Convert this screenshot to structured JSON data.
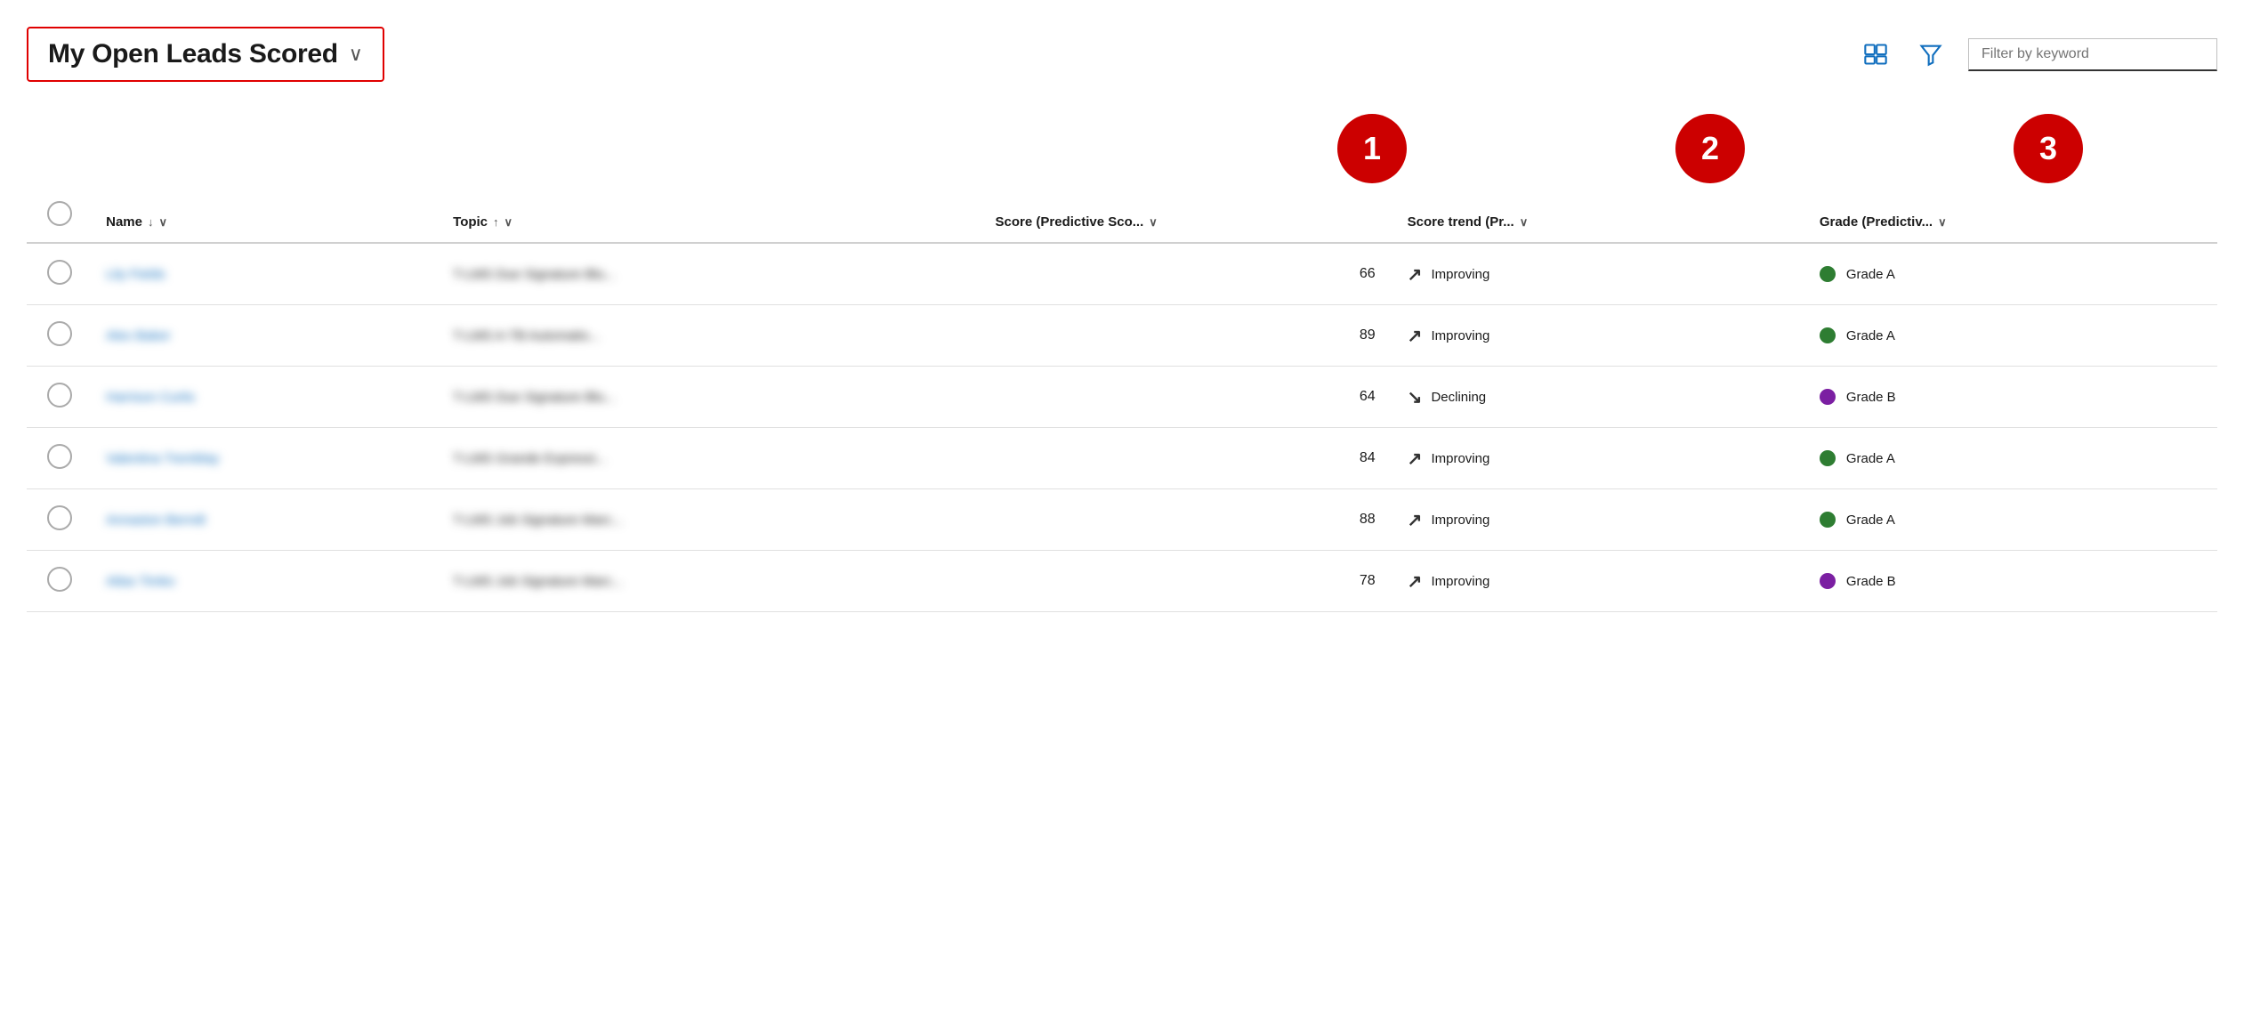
{
  "header": {
    "title": "My Open Leads Scored",
    "chevron": "∨",
    "filter_placeholder": "Filter by keyword"
  },
  "icons": {
    "layout_icon": "layout",
    "filter_icon": "filter"
  },
  "annotations": [
    {
      "number": "1"
    },
    {
      "number": "2"
    },
    {
      "number": "3"
    }
  ],
  "table": {
    "columns": [
      {
        "id": "checkbox",
        "label": ""
      },
      {
        "id": "name",
        "label": "Name",
        "sort": "↓",
        "has_chevron": true
      },
      {
        "id": "topic",
        "label": "Topic",
        "sort": "↑",
        "has_chevron": true
      },
      {
        "id": "score",
        "label": "Score (Predictive Sco...",
        "has_chevron": true
      },
      {
        "id": "trend",
        "label": "Score trend (Pr...",
        "has_chevron": true
      },
      {
        "id": "grade",
        "label": "Grade (Predictiv...",
        "has_chevron": true
      }
    ],
    "rows": [
      {
        "name": "Lily Fields",
        "topic": "T-LMS Due Signature Blu...",
        "score": 66,
        "trend_arrow": "↗",
        "trend_direction": "up",
        "trend_label": "Improving",
        "grade_color": "green",
        "grade_label": "Grade A"
      },
      {
        "name": "Alex Baker",
        "topic": "T-LMS A-TB Automatio...",
        "score": 89,
        "trend_arrow": "↗",
        "trend_direction": "up",
        "trend_label": "Improving",
        "grade_color": "green",
        "grade_label": "Grade A"
      },
      {
        "name": "Harrison Curtis",
        "topic": "T-LMS Due Signature Blu...",
        "score": 64,
        "trend_arrow": "↘",
        "trend_direction": "down",
        "trend_label": "Declining",
        "grade_color": "purple",
        "grade_label": "Grade B"
      },
      {
        "name": "Valentina Tremblay",
        "topic": "T-LMS Grande Expressi...",
        "score": 84,
        "trend_arrow": "↗",
        "trend_direction": "up",
        "trend_label": "Improving",
        "grade_color": "green",
        "grade_label": "Grade A"
      },
      {
        "name": "Annaston Berndt",
        "topic": "T-LMS Job Signature Marc...",
        "score": 88,
        "trend_arrow": "↗",
        "trend_direction": "up",
        "trend_label": "Improving",
        "grade_color": "green",
        "grade_label": "Grade A"
      },
      {
        "name": "Atlas Timko",
        "topic": "T-LMS Job Signature Marc...",
        "score": 78,
        "trend_arrow": "↗",
        "trend_direction": "up",
        "trend_label": "Improving",
        "grade_color": "purple",
        "grade_label": "Grade B"
      }
    ]
  }
}
